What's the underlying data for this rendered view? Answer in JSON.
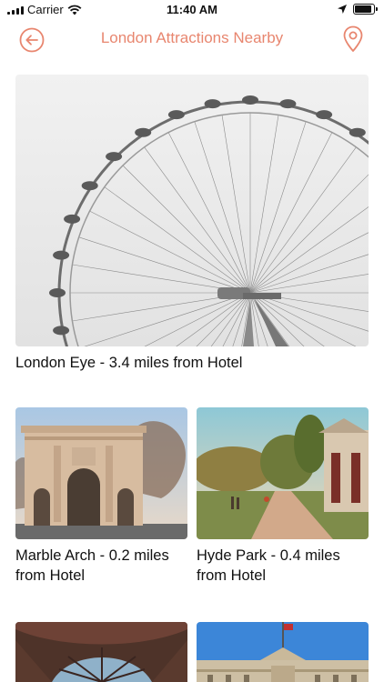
{
  "status_bar": {
    "carrier": "Carrier",
    "time": "11:40 AM",
    "battery_level": 0.9
  },
  "nav": {
    "title": "London Attractions Nearby",
    "back_icon": "back-arrow-circle-icon",
    "location_icon": "map-pin-icon",
    "accent_color": "#e8866f"
  },
  "attractions": [
    {
      "name": "London Eye - 3.4 miles from Hotel"
    },
    {
      "name": "Marble Arch - 0.2 miles from Hotel"
    },
    {
      "name": "Hyde Park - 0.4 miles from Hotel"
    },
    {
      "name": ""
    },
    {
      "name": ""
    }
  ]
}
